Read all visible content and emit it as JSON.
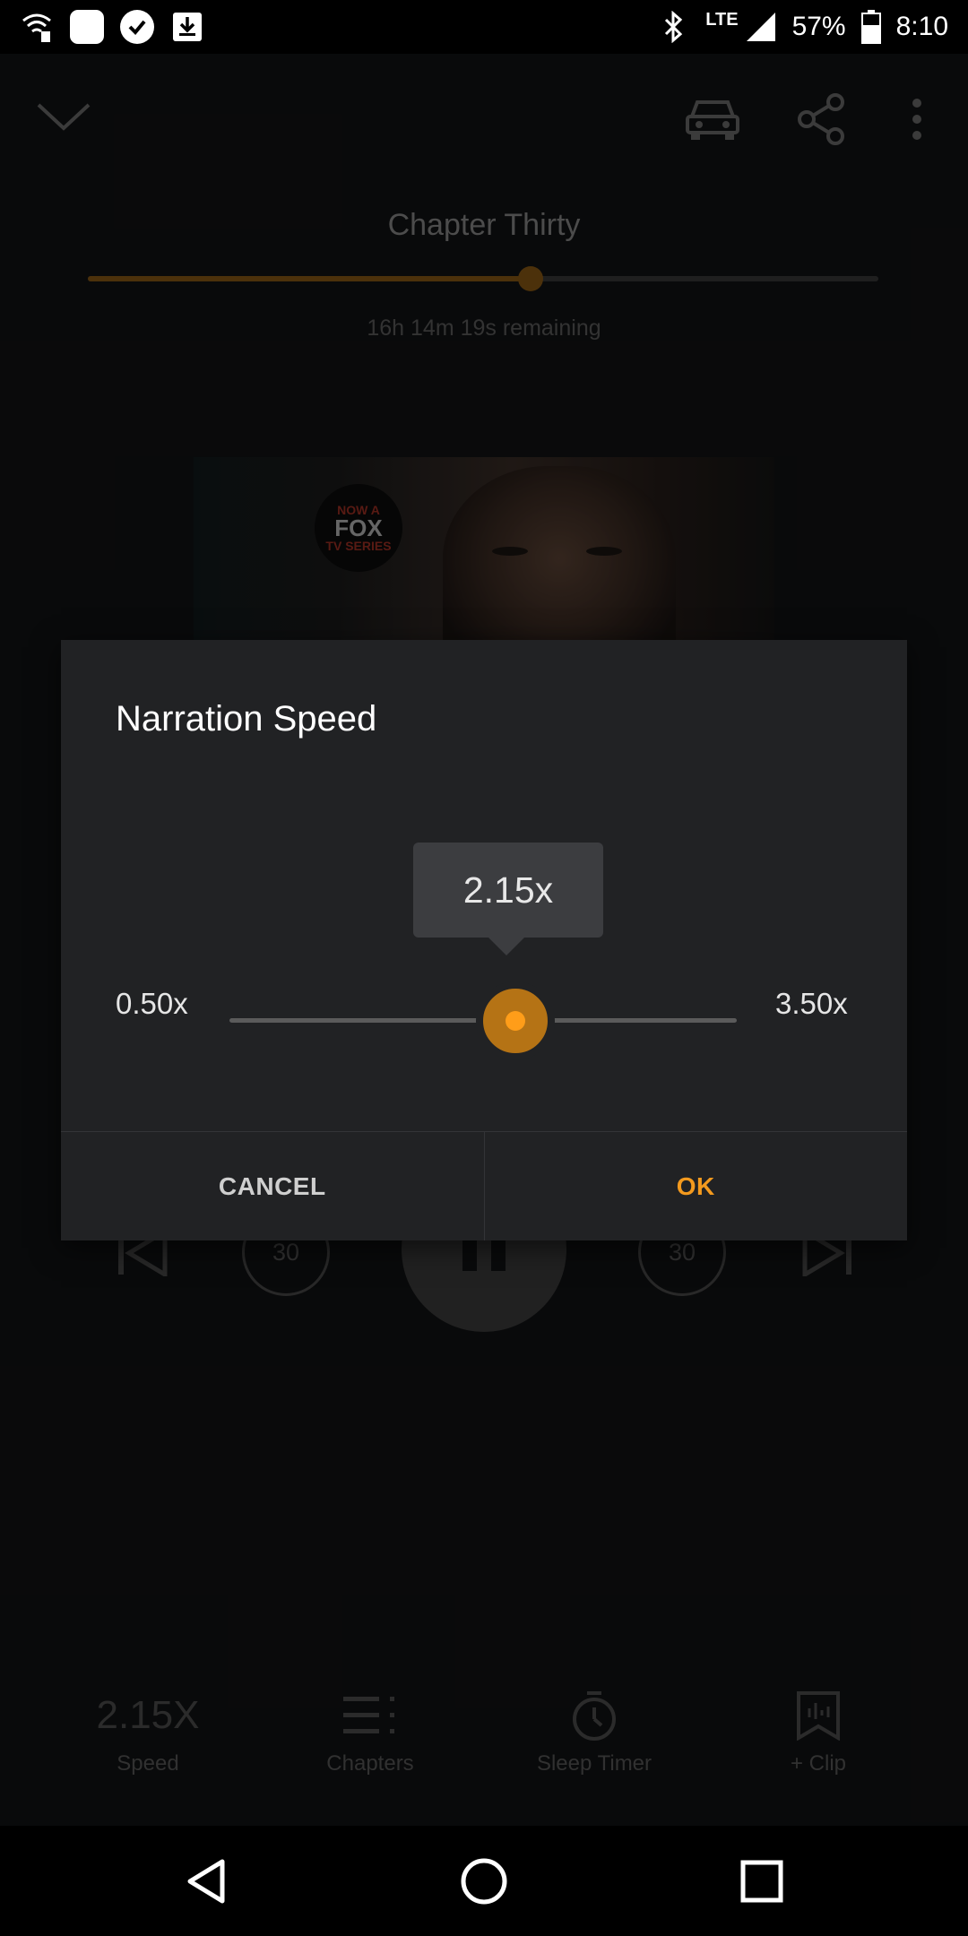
{
  "status_bar": {
    "network": "LTE",
    "battery": "57%",
    "time": "8:10"
  },
  "player": {
    "chapter_title": "Chapter Thirty",
    "progress": 0.56,
    "remaining": "16h 14m 19s remaining",
    "cover_badge": {
      "line1": "NOW A",
      "line2": "FOX",
      "line3": "TV SERIES"
    },
    "skip_back_seconds": "30",
    "skip_forward_seconds": "30"
  },
  "bottom_toolbar": {
    "speed_value": "2.15X",
    "speed_label": "Speed",
    "chapters_label": "Chapters",
    "sleep_timer_label": "Sleep Timer",
    "clip_label": "+ Clip"
  },
  "dialog": {
    "title": "Narration Speed",
    "current_value": "2.15x",
    "min_label": "0.50x",
    "max_label": "3.50x",
    "slider_position": 0.55,
    "cancel_label": "CANCEL",
    "ok_label": "OK"
  },
  "colors": {
    "accent": "#f39a1e",
    "dim_accent": "#8a5a14",
    "dialog_bg": "#212224"
  }
}
